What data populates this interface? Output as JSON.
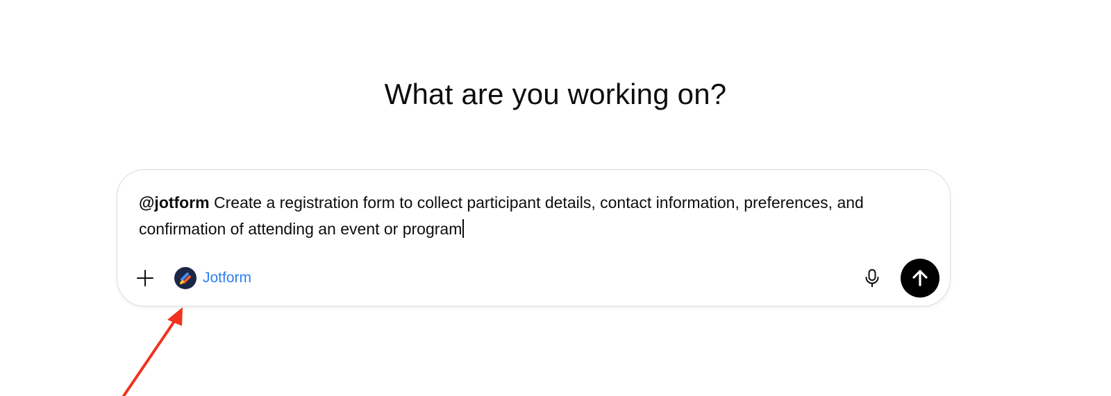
{
  "heading": "What are you working on?",
  "composer": {
    "mention": "@jotform",
    "prompt_text": " Create a registration form to collect participant details, contact information, preferences, and confirmation of attending an event or program"
  },
  "toolbar": {
    "add_icon": "plus-icon",
    "app_chip_label": "Jotform",
    "app_chip_icon": "jotform-logo-icon",
    "mic_icon": "microphone-icon",
    "send_icon": "arrow-up-icon"
  },
  "colors": {
    "app_chip_text": "#2d7ff0",
    "send_button_bg": "#000000",
    "annotation_arrow": "#f0321e"
  }
}
